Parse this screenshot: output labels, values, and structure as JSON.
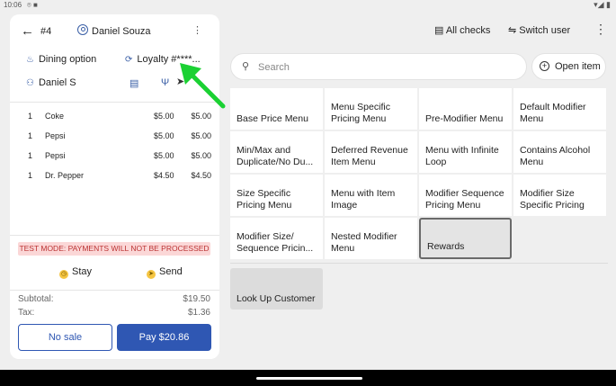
{
  "status_bar": {
    "time": "10:06",
    "left_icons": "⌾ ■",
    "right_icons": "▾◢ ▮"
  },
  "order": {
    "number": "#4",
    "customer": "Daniel Souza",
    "dining_option": "Dining option",
    "loyalty": "Loyalty #****...",
    "guest": "Daniel S",
    "items": [
      {
        "qty": "1",
        "name": "Coke",
        "price": "$5.00",
        "total": "$5.00"
      },
      {
        "qty": "1",
        "name": "Pepsi",
        "price": "$5.00",
        "total": "$5.00"
      },
      {
        "qty": "1",
        "name": "Pepsi",
        "price": "$5.00",
        "total": "$5.00"
      },
      {
        "qty": "1",
        "name": "Dr. Pepper",
        "price": "$4.50",
        "total": "$4.50"
      }
    ],
    "test_mode": "TEST MODE:  PAYMENTS WILL NOT BE PROCESSED",
    "stay_label": "Stay",
    "send_label": "Send",
    "subtotal_label": "Subtotal:",
    "subtotal": "$19.50",
    "tax_label": "Tax:",
    "tax": "$1.36",
    "no_sale_label": "No sale",
    "pay_label": "Pay $20.86"
  },
  "header": {
    "all_checks": "All checks",
    "switch_user": "Switch user"
  },
  "search": {
    "placeholder": "Search"
  },
  "open_item": "Open item",
  "menu_tiles": [
    "Base Price Menu",
    "Menu Specific Pricing Menu",
    "Pre-Modifier Menu",
    "Default Modifier Menu",
    "Min/Max and Duplicate/No Du...",
    "Deferred Revenue Item Menu",
    "Menu with Infinite Loop",
    "Contains Alcohol Menu",
    "Size Specific Pricing Menu",
    "Menu with Item Image",
    "Modifier Sequence Pricing Menu",
    "Modifier Size Specific Pricing",
    "Modifier Size/ Sequence Pricin...",
    "Nested Modifier Menu",
    "Rewards"
  ],
  "lookup_customer": "Look Up Customer",
  "colors": {
    "accent": "#2f57b3",
    "test_mode_bg": "#fbd7d7",
    "arrow": "#1bd133"
  }
}
